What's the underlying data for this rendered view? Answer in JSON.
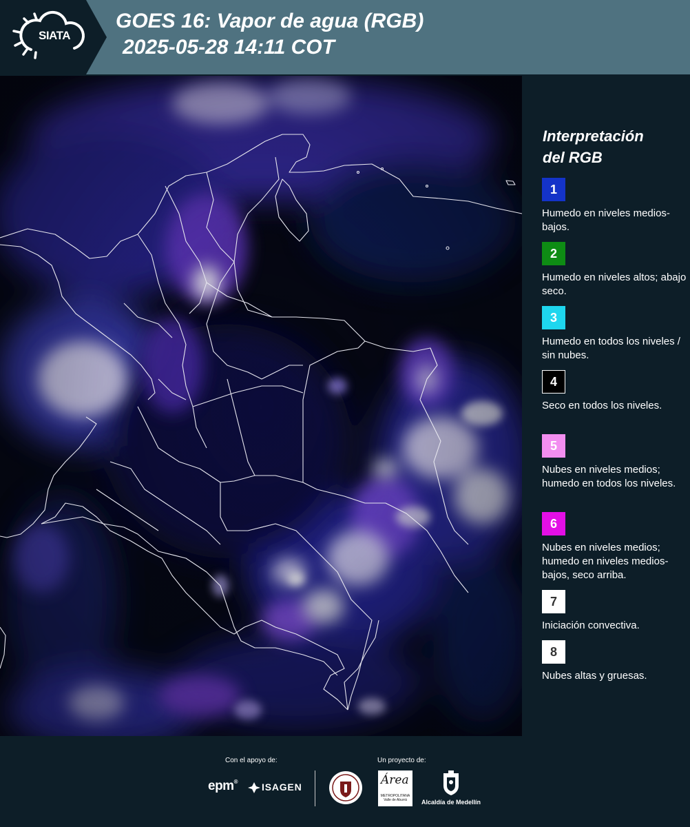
{
  "header": {
    "logo_text": "SIATA",
    "title_line1": "GOES 16: Vapor de agua (RGB)",
    "title_line2": "2025-05-28 14:11 COT",
    "background_color": "#4f7280"
  },
  "map": {
    "description_icons": [
      "satellite-imagery",
      "country-borders",
      "department-borders"
    ],
    "background_color": "#05060a"
  },
  "legend": {
    "title_line1": "Interpretación",
    "title_line2": "del RGB",
    "items": [
      {
        "num": "1",
        "color": "#1433c8",
        "text_color": "#ffffff",
        "desc": "Humedo en niveles medios-bajos."
      },
      {
        "num": "2",
        "color": "#0e8c14",
        "text_color": "#ffffff",
        "desc": "Humedo en niveles altos; abajo seco."
      },
      {
        "num": "3",
        "color": "#1ed6ee",
        "text_color": "#ffffff",
        "desc": "Humedo en todos los niveles / sin nubes."
      },
      {
        "num": "4",
        "color": "#000000",
        "text_color": "#ffffff",
        "desc": "Seco en todos los niveles."
      },
      {
        "num": "5",
        "color": "#f28ef0",
        "text_color": "#ffffff",
        "desc": "Nubes en niveles medios; humedo en todos los niveles."
      },
      {
        "num": "6",
        "color": "#e30fe6",
        "text_color": "#ffffff",
        "desc": "Nubes en niveles medios; humedo en niveles medios-bajos, seco arriba."
      },
      {
        "num": "7",
        "color": "#ffffff",
        "text_color": "#333333",
        "desc": "Iniciación convectiva."
      },
      {
        "num": "8",
        "color": "#ffffff",
        "text_color": "#333333",
        "desc": "Nubes altas y gruesas."
      }
    ]
  },
  "footer": {
    "support_label": "Con el apoyo de:",
    "project_label": "Un proyecto de:",
    "epm": "epm",
    "isagen": "ISAGEN",
    "area_script": "Área",
    "area_small": "METROPOLITANA Valle de Aburrá",
    "alcaldia": "Alcaldía de Medellín"
  }
}
